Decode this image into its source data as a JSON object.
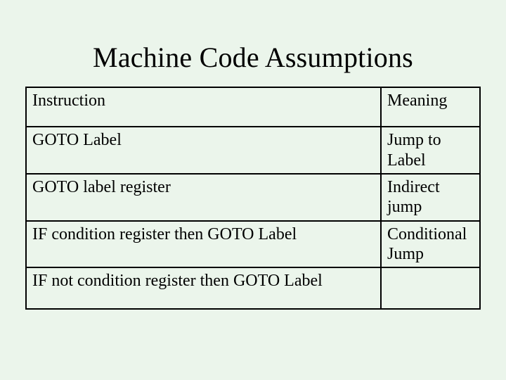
{
  "title": "Machine Code Assumptions",
  "table": {
    "headers": {
      "c1": "Instruction",
      "c2": "Meaning"
    },
    "rows": [
      {
        "instruction": "GOTO Label",
        "meaning": "Jump to Label"
      },
      {
        "instruction": "GOTO label register",
        "meaning": "Indirect jump"
      },
      {
        "instruction": "IF condition register then GOTO Label",
        "meaning": "Conditional Jump"
      },
      {
        "instruction": "IF not condition register then GOTO Label",
        "meaning": ""
      }
    ]
  },
  "chart_data": {
    "type": "table",
    "title": "Machine Code Assumptions",
    "columns": [
      "Instruction",
      "Meaning"
    ],
    "rows": [
      [
        "GOTO Label",
        "Jump to Label"
      ],
      [
        "GOTO label register",
        "Indirect jump"
      ],
      [
        "IF condition register then GOTO Label",
        "Conditional Jump"
      ],
      [
        "IF not condition register then GOTO Label",
        ""
      ]
    ]
  }
}
